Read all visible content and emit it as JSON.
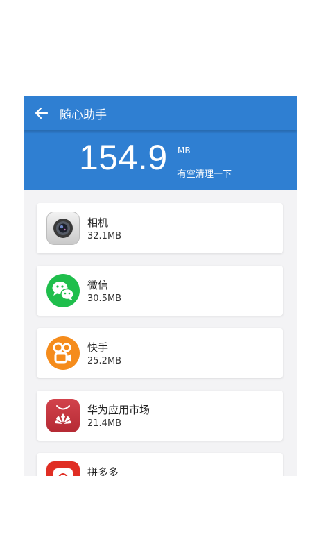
{
  "header": {
    "title": "随心助手",
    "back_icon": "arrow-left-icon"
  },
  "summary": {
    "value": "154.9",
    "unit": "MB",
    "hint": "有空清理一下"
  },
  "apps": [
    {
      "name": "相机",
      "size": "32.1MB",
      "icon": "camera-icon"
    },
    {
      "name": "微信",
      "size": "30.5MB",
      "icon": "wechat-icon"
    },
    {
      "name": "快手",
      "size": "25.2MB",
      "icon": "kuaishou-icon"
    },
    {
      "name": "华为应用市场",
      "size": "21.4MB",
      "icon": "huawei-appgallery-icon"
    },
    {
      "name": "拼多多",
      "size": "",
      "icon": "pinduoduo-icon"
    }
  ],
  "colors": {
    "header_blue": "#2f7fd2",
    "background": "#f3f3f5",
    "wechat_green": "#1fbe4c",
    "kuaishou_orange": "#f58c1c",
    "huawei_red": "#c8343e",
    "pinduoduo_red": "#e02e24"
  }
}
